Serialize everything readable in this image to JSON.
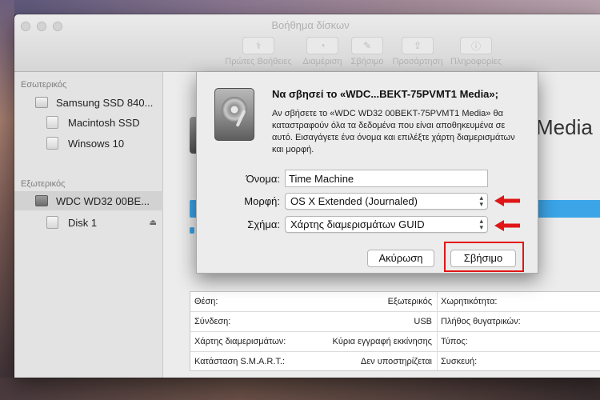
{
  "window": {
    "title": "Βοήθημα δίσκων"
  },
  "toolbar": {
    "items": [
      {
        "label": "Πρώτες Βοήθειες",
        "icon": "stethoscope-icon"
      },
      {
        "label": "Διαμέριση",
        "icon": "pie-chart-icon"
      },
      {
        "label": "Σβήσιμο",
        "icon": "eraser-icon"
      },
      {
        "label": "Προσάρτηση",
        "icon": "mount-icon"
      },
      {
        "label": "Πληροφορίες",
        "icon": "info-icon"
      }
    ]
  },
  "sidebar": {
    "internal_label": "Εσωτερικός",
    "external_label": "Εξωτερικός",
    "items": [
      {
        "label": "Samsung SSD 840..."
      },
      {
        "label": "Macintosh SSD"
      },
      {
        "label": "Winsows 10"
      },
      {
        "label": "WDC WD32 00BE..."
      },
      {
        "label": "Disk 1"
      }
    ]
  },
  "content": {
    "title_fragment": "Media"
  },
  "info_table": {
    "rows": [
      {
        "label": "Θέση:",
        "value": "Εξωτερικός",
        "label2": "Χωρητικότητα:"
      },
      {
        "label": "Σύνδεση:",
        "value": "USB",
        "label2": "Πλήθος θυγατρικών:"
      },
      {
        "label": "Χάρτης διαμερισμάτων:",
        "value": "Κύρια εγγραφή εκκίνησης",
        "label2": "Τύπος:"
      },
      {
        "label": "Κατάσταση S.M.A.R.T.:",
        "value": "Δεν υποστηρίζεται",
        "label2": "Συσκευή:"
      }
    ]
  },
  "dialog": {
    "title": "Να σβησεί το «WDC...BEKT-75PVMT1 Media»;",
    "message": "Αν σβήσετε το «WDC WD32 00BEKT-75PVMT1 Media» θα καταστραφούν όλα τα δεδομένα που είναι αποθηκευμένα σε αυτό. Εισαγάγετε ένα όνομα και επιλέξτε χάρτη διαμερισμάτων και μορφή.",
    "name_label": "Όνομα:",
    "name_value": "Time Machine",
    "format_label": "Μορφή:",
    "format_value": "OS X Extended (Journaled)",
    "scheme_label": "Σχήμα:",
    "scheme_value": "Χάρτης διαμερισμάτων GUID",
    "cancel_label": "Ακύρωση",
    "erase_label": "Σβήσιμο"
  },
  "colors": {
    "accent_blue": "#3ba5e8",
    "annotation_red": "#e01616"
  }
}
